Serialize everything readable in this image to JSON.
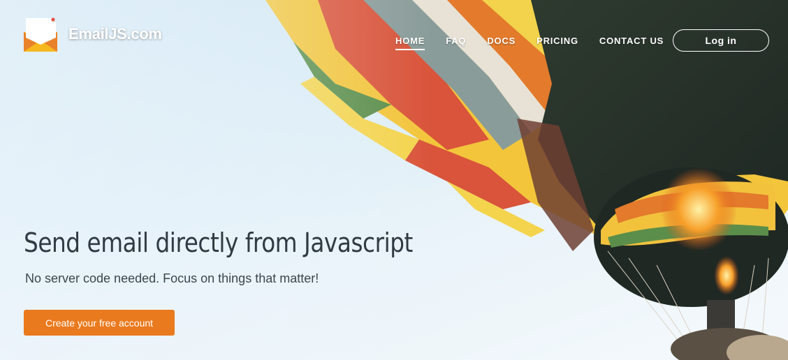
{
  "brand": {
    "logo_text": "EmailJS.com",
    "logo_icon": "envelope-icon"
  },
  "nav": {
    "items": [
      {
        "label": "HOME",
        "active": true
      },
      {
        "label": "FAQ",
        "active": false
      },
      {
        "label": "DOCS",
        "active": false
      },
      {
        "label": "PRICING",
        "active": false
      },
      {
        "label": "CONTACT US",
        "active": false
      }
    ],
    "login_label": "Log in"
  },
  "hero": {
    "headline": "Send email directly from Javascript",
    "subline": "No server code needed. Focus on things that matter!",
    "cta_label": "Create your free account",
    "background_image": "hot-air-balloon-photo"
  },
  "colors": {
    "accent": "#ea7a1e",
    "headline": "#2f3a43",
    "sky": "#d6eaf6"
  }
}
